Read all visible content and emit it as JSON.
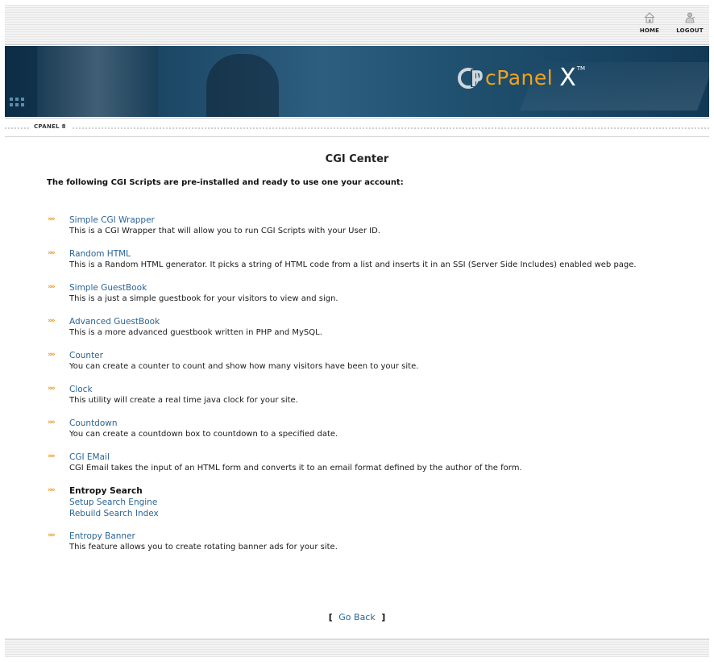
{
  "topnav": {
    "home_label": "HOME",
    "logout_label": "LOGOUT"
  },
  "banner": {
    "logo_text": "cPanel",
    "logo_x": "X",
    "logo_tm": "TM"
  },
  "breadcrumb": "CPANEL 8",
  "page": {
    "title": "CGI Center",
    "intro": "The following CGI Scripts are pre-installed and ready to use one your account:"
  },
  "scripts": [
    {
      "name": "Simple CGI Wrapper",
      "description": "This is a CGI Wrapper that will allow you to run CGI Scripts with your User ID."
    },
    {
      "name": "Random HTML",
      "description": "This is a Random HTML generator. It picks a string of HTML code from a list and inserts it in an SSI (Server Side Includes) enabled web page."
    },
    {
      "name": "Simple GuestBook",
      "description": "This is a just a simple guestbook for your visitors to view and sign."
    },
    {
      "name": "Advanced GuestBook",
      "description": "This is a more advanced guestbook written in PHP and MySQL."
    },
    {
      "name": "Counter",
      "description": "You can create a counter to count and show how many visitors have been to your site."
    },
    {
      "name": "Clock",
      "description": "This utility will create a real time java clock for your site."
    },
    {
      "name": "Countdown",
      "description": "You can create a countdown box to countdown to a specified date."
    },
    {
      "name": "CGI EMail",
      "description": "CGI Email takes the input of an HTML form and converts it to an email format defined by the author of the form."
    }
  ],
  "entropy_search": {
    "heading": "Entropy Search",
    "setup_link": "Setup Search Engine",
    "rebuild_link": "Rebuild Search Index"
  },
  "entropy_banner": {
    "name": "Entropy Banner",
    "description": "This feature allows you to create rotating banner ads for your site."
  },
  "footer": {
    "bracket_open": "[",
    "go_back": "Go Back",
    "bracket_close": "]"
  },
  "colors": {
    "link": "#2a6497",
    "bullet": "#f09a2a",
    "logo_orange": "#f3a21b",
    "banner_dark": "#0d2c45"
  },
  "icons": {
    "bullet": "double-chevron-right-icon",
    "home": "house-icon",
    "logout": "person-icon"
  }
}
